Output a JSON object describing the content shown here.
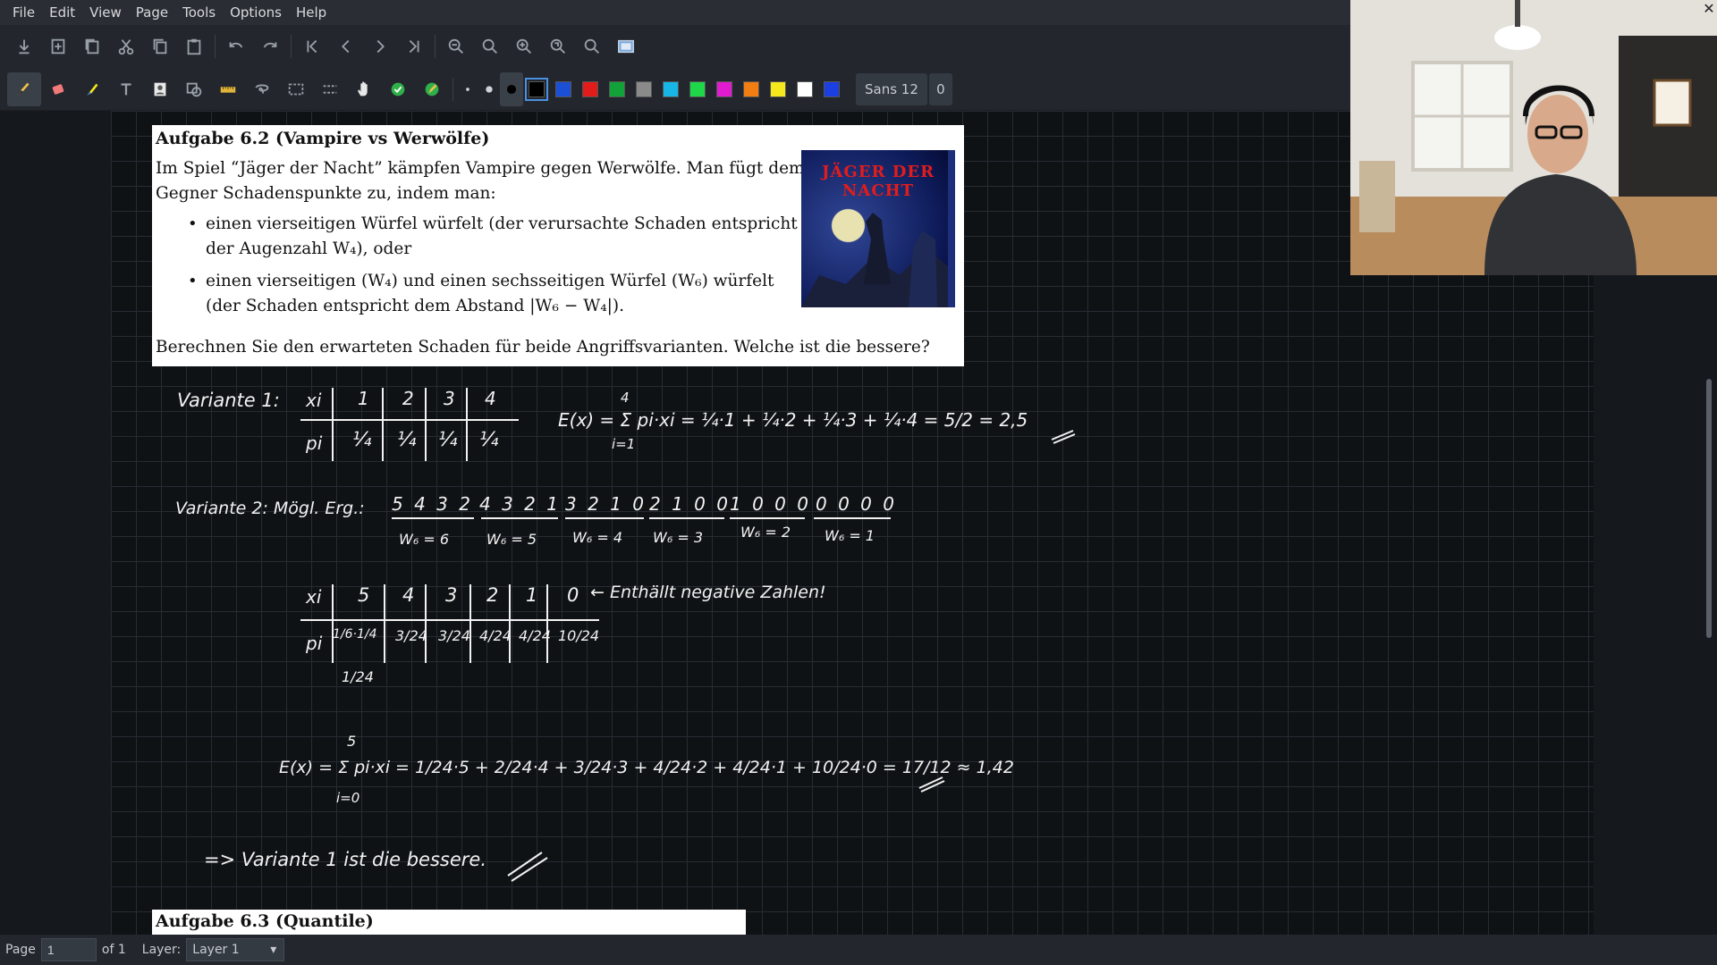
{
  "menu": [
    "File",
    "Edit",
    "View",
    "Page",
    "Tools",
    "Options",
    "Help"
  ],
  "toolbar": {
    "font_label": "Sans 12",
    "font_size_extra": "0",
    "colors": [
      "#000000",
      "#1a4fd6",
      "#e21b1b",
      "#13a23a",
      "#8a8a8a",
      "#17b6e6",
      "#1ed84a",
      "#e01bd0",
      "#f07e12",
      "#f5e81c",
      "#ffffff",
      "#1b3fe0"
    ],
    "tool_icons": [
      "pen-icon",
      "eraser-icon",
      "highlighter-icon",
      "text-icon",
      "image-icon",
      "shape-icon",
      "ruler-icon",
      "lasso-icon",
      "rect-select-icon",
      "vertical-space-icon",
      "hand-icon",
      "shape-recognizer-icon",
      "default-tool-icon"
    ],
    "file_icons": [
      "save-icon",
      "new-page-icon",
      "copy-page-icon",
      "cut-icon",
      "copy-icon",
      "paste-icon",
      "undo-icon",
      "redo-icon",
      "first-page-icon",
      "prev-page-icon",
      "next-page-icon",
      "last-page-icon",
      "zoom-out-icon",
      "zoom-fit-icon",
      "zoom-in-icon",
      "zoom-100-icon",
      "zoom-icon",
      "fullscreen-icon"
    ]
  },
  "exercise": {
    "title": "Aufgabe 6.2 (Vampire vs Werwölfe)",
    "intro_1": "Im Spiel “Jäger der Nacht” kämpfen Vampire gegen Werwölfe. Man fügt dem",
    "intro_2": "Gegner Schadenspunkte zu, indem man:",
    "bullet1_line1": "einen vierseitigen Würfel würfelt (der verursachte Schaden entspricht",
    "bullet1_line2": "der Augenzahl W₄), oder",
    "bullet2_line1": "einen vierseitigen (W₄) und einen sechsseitigen Würfel (W₆) würfelt",
    "bullet2_line2": "(der Schaden entspricht dem Abstand |W₆ − W₄|).",
    "question": "Berechnen Sie den erwarteten Schaden für beide Angriffsvarianten. Welche ist die bessere?",
    "image_title": "JÄGER DER NACHT"
  },
  "next_exercise": {
    "title": "Aufgabe 6.3 (Quantile)"
  },
  "handwriting": {
    "v1_label": "Variante 1:",
    "v1_xi": [
      "xi",
      "1",
      "2",
      "3",
      "4"
    ],
    "v1_pi": [
      "pi",
      "¼",
      "¼",
      "¼",
      "¼"
    ],
    "v1_ex": "E(x) = Σ pi·xi = ¼·1 + ¼·2 + ¼·3 + ¼·4 = 5/2 = 2,5",
    "v1_sum_top": "4",
    "v1_sum_bottom": "i=1",
    "v2_label": "Variante 2:  Mögl. Erg.:",
    "v2_groups": [
      "5 4 3 2",
      "4 3 2 1",
      "3 2 1 0",
      "2 1 0 0",
      "1 0 0 0",
      "0 0 0 0"
    ],
    "v2_group_labels": [
      "W₆ = 6",
      "W₆ = 5",
      "W₆ = 4",
      "W₆ = 3",
      "W₆ = 2",
      "W₆ = 1"
    ],
    "v2_xi": [
      "xi",
      "5",
      "4",
      "3",
      "2",
      "1",
      "0"
    ],
    "v2_pi": [
      "pi",
      "1/6·1/4",
      "3/24",
      "3/24",
      "4/24",
      "4/24",
      "10/24"
    ],
    "v2_note": "← Enthällt negative Zahlen!",
    "v2_first_prob": "1/24",
    "v2_ex": "E(x) = Σ pi·xi = 1/24·5 + 2/24·4 + 3/24·3 + 4/24·2 + 4/24·1 + 10/24·0 = 17/12 ≈ 1,42",
    "v2_sum_top": "5",
    "v2_sum_bottom": "i=0",
    "conclusion": "=> Variante 1 ist die bessere."
  },
  "status": {
    "page_label": "Page",
    "page_value": "1",
    "of_label": "of 1",
    "layer_label": "Layer:",
    "layer_value": "Layer 1"
  }
}
